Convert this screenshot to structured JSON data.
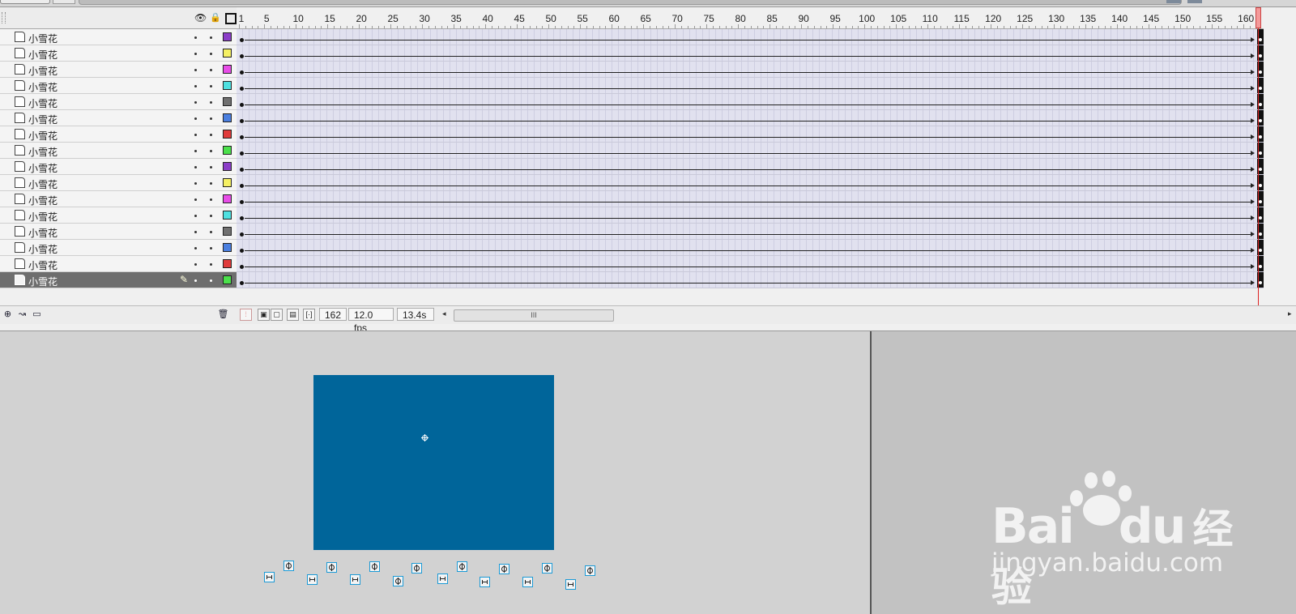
{
  "timeline": {
    "frame_numbers": [
      "1",
      "5",
      "10",
      "15",
      "20",
      "25",
      "30",
      "35",
      "40",
      "45",
      "50",
      "55",
      "60",
      "65",
      "70",
      "75",
      "80",
      "85",
      "90",
      "95",
      "100",
      "105",
      "110",
      "115",
      "120",
      "125",
      "130",
      "135",
      "140",
      "145",
      "150",
      "155",
      "160"
    ],
    "current_frame": "162",
    "frame_rate": "12.0 fps",
    "elapsed_time": "13.4s",
    "scroll_grip": "III"
  },
  "layer_header": {
    "eye_icon": "eye-icon",
    "lock_icon": "lock-icon",
    "outline_icon": "outline-icon"
  },
  "layers": [
    {
      "name": "小雪花",
      "color": "#8b3dc8"
    },
    {
      "name": "小雪花",
      "color": "#f5f063"
    },
    {
      "name": "小雪花",
      "color": "#e84de8"
    },
    {
      "name": "小雪花",
      "color": "#4ee0e0"
    },
    {
      "name": "小雪花",
      "color": "#707070"
    },
    {
      "name": "小雪花",
      "color": "#4a7fe0"
    },
    {
      "name": "小雪花",
      "color": "#e03b3b"
    },
    {
      "name": "小雪花",
      "color": "#4be04b"
    },
    {
      "name": "小雪花",
      "color": "#8b3dc8"
    },
    {
      "name": "小雪花",
      "color": "#f5f063"
    },
    {
      "name": "小雪花",
      "color": "#e84de8"
    },
    {
      "name": "小雪花",
      "color": "#4ee0e0"
    },
    {
      "name": "小雪花",
      "color": "#707070"
    },
    {
      "name": "小雪花",
      "color": "#4a7fe0"
    },
    {
      "name": "小雪花",
      "color": "#e03b3b"
    },
    {
      "name": "小雪花",
      "color": "#4be04b",
      "selected": true
    }
  ],
  "stage": {
    "canvas_color": "#00659a"
  },
  "watermark": {
    "logo": "Bai",
    "logo_du": "du",
    "logo_cn": "经验",
    "url": "jingyan.baidu.com"
  }
}
